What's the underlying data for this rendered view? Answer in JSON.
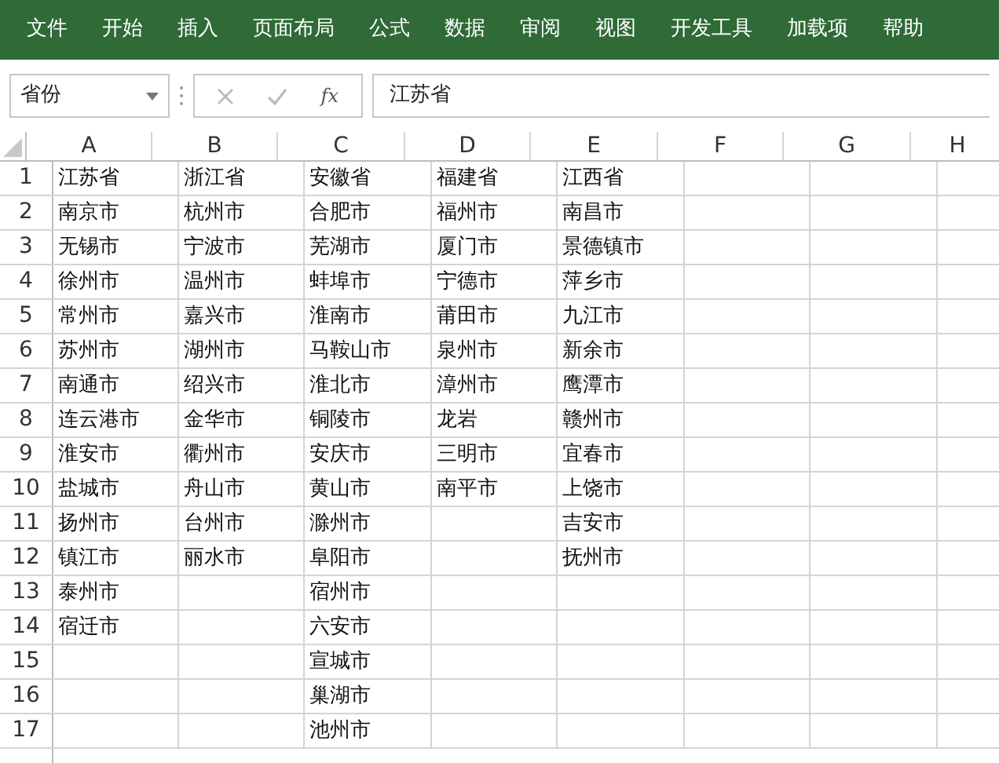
{
  "ribbon_tabs": [
    "文件",
    "开始",
    "插入",
    "页面布局",
    "公式",
    "数据",
    "审阅",
    "视图",
    "开发工具",
    "加载项",
    "帮助"
  ],
  "name_box": {
    "value": "省份"
  },
  "formula_bar": {
    "function_label": "fx",
    "value": "江苏省"
  },
  "columns": [
    "A",
    "B",
    "C",
    "D",
    "E",
    "F",
    "G",
    "H"
  ],
  "rows": [
    {
      "number": "1",
      "cells": [
        "江苏省",
        "浙江省",
        "安徽省",
        "福建省",
        "江西省"
      ]
    },
    {
      "number": "2",
      "cells": [
        "南京市",
        "杭州市",
        "合肥市",
        "福州市",
        "南昌市"
      ]
    },
    {
      "number": "3",
      "cells": [
        "无锡市",
        "宁波市",
        "芜湖市",
        "厦门市",
        "景德镇市"
      ]
    },
    {
      "number": "4",
      "cells": [
        "徐州市",
        "温州市",
        "蚌埠市",
        "宁德市",
        "萍乡市"
      ]
    },
    {
      "number": "5",
      "cells": [
        "常州市",
        "嘉兴市",
        "淮南市",
        "莆田市",
        "九江市"
      ]
    },
    {
      "number": "6",
      "cells": [
        "苏州市",
        "湖州市",
        "马鞍山市",
        "泉州市",
        "新余市"
      ]
    },
    {
      "number": "7",
      "cells": [
        "南通市",
        "绍兴市",
        "淮北市",
        "漳州市",
        "鹰潭市"
      ]
    },
    {
      "number": "8",
      "cells": [
        "连云港市",
        "金华市",
        "铜陵市",
        "龙岩",
        "赣州市"
      ]
    },
    {
      "number": "9",
      "cells": [
        "淮安市",
        "衢州市",
        "安庆市",
        "三明市",
        "宜春市"
      ]
    },
    {
      "number": "10",
      "cells": [
        "盐城市",
        "舟山市",
        "黄山市",
        "南平市",
        "上饶市"
      ]
    },
    {
      "number": "11",
      "cells": [
        "扬州市",
        "台州市",
        "滁州市",
        null,
        "吉安市"
      ]
    },
    {
      "number": "12",
      "cells": [
        "镇江市",
        "丽水市",
        "阜阳市",
        null,
        "抚州市"
      ]
    },
    {
      "number": "13",
      "cells": [
        "泰州市",
        null,
        "宿州市"
      ]
    },
    {
      "number": "14",
      "cells": [
        "宿迁市",
        null,
        "六安市"
      ]
    },
    {
      "number": "15",
      "cells": [
        null,
        null,
        "宣城市"
      ]
    },
    {
      "number": "16",
      "cells": [
        null,
        null,
        "巢湖市"
      ]
    },
    {
      "number": "17",
      "cells": [
        null,
        null,
        "池州市"
      ]
    }
  ]
}
